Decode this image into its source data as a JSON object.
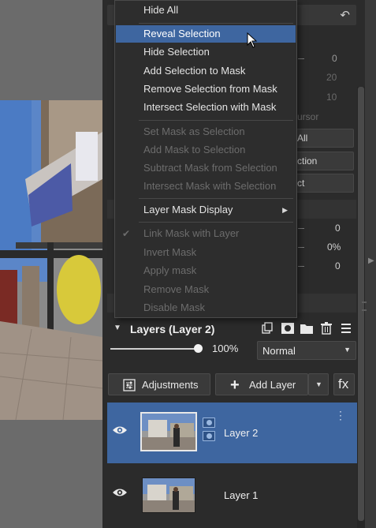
{
  "context_menu": {
    "items": [
      {
        "label": "Hide All",
        "enabled": true
      },
      {
        "label": "Reveal Selection",
        "enabled": true,
        "highlighted": true
      },
      {
        "label": "Hide Selection",
        "enabled": true
      },
      {
        "label": "Add Selection to Mask",
        "enabled": true
      },
      {
        "label": "Remove Selection from Mask",
        "enabled": true
      },
      {
        "label": "Intersect Selection with Mask",
        "enabled": true
      },
      {
        "label": "Set Mask as Selection",
        "enabled": false
      },
      {
        "label": "Add Mask to Selection",
        "enabled": false
      },
      {
        "label": "Subtract Mask from Selection",
        "enabled": false
      },
      {
        "label": "Intersect Mask with Selection",
        "enabled": false
      },
      {
        "label": "Layer Mask Display",
        "enabled": true,
        "submenu": true
      },
      {
        "label": "Link Mask with Layer",
        "enabled": false,
        "checked": true
      },
      {
        "label": "Invert Mask",
        "enabled": false
      },
      {
        "label": "Apply mask",
        "enabled": false
      },
      {
        "label": "Remove Mask",
        "enabled": false
      },
      {
        "label": "Disable Mask",
        "enabled": false
      }
    ]
  },
  "behind_menu": {
    "values": [
      "0",
      "20",
      "10",
      "0",
      "0%",
      "0"
    ],
    "partial_labels": [
      "ursor",
      "All",
      "ction",
      "ct"
    ]
  },
  "layers": {
    "title": "Layers (Layer 2)",
    "opacity": "100%",
    "opacity_fraction": 1.0,
    "blend_mode": "Normal",
    "adjustments_label": "Adjustments",
    "add_layer_label": "Add Layer",
    "fx_label": "fx",
    "rows": [
      {
        "name": "Layer 2",
        "selected": true,
        "visible": true,
        "has_mask": true
      },
      {
        "name": "Layer 1",
        "selected": false,
        "visible": true,
        "has_mask": false
      }
    ]
  },
  "icons": {
    "undo": "undo-icon",
    "collapse": "collapse-triangle-icon",
    "new_layer": "new-layer-icon",
    "mask": "mask-icon",
    "folder": "folder-icon",
    "trash": "trash-icon",
    "menu": "hamburger-menu-icon",
    "eye": "eye-icon",
    "plus": "plus-icon"
  },
  "colors": {
    "accent": "#3e66a0",
    "panel": "#2b2b2b",
    "menu_bg": "#2d2d2d"
  }
}
